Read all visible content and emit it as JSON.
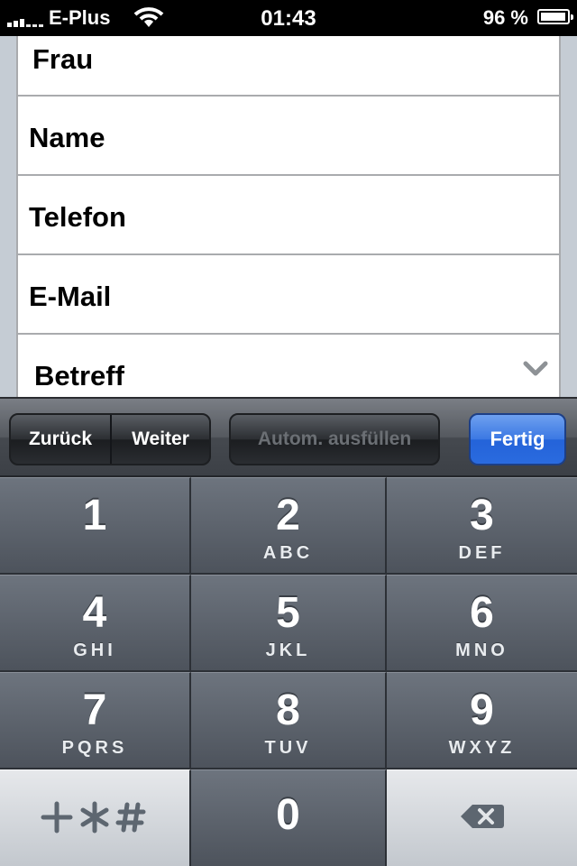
{
  "status_bar": {
    "carrier": "E-Plus",
    "time": "01:43",
    "battery": "96 %",
    "signal_icon": "signal-bars-icon",
    "wifi_icon": "wifi-icon",
    "battery_icon": "battery-icon"
  },
  "form": {
    "fields": [
      {
        "label": "Frau"
      },
      {
        "label": "Name"
      },
      {
        "label": "Telefon"
      },
      {
        "label": "E-Mail"
      },
      {
        "label": "Betreff",
        "icon": "chevron-down-icon"
      }
    ]
  },
  "toolbar": {
    "prev_label": "Zurück",
    "next_label": "Weiter",
    "autofill_label": "Autom. ausfüllen",
    "done_label": "Fertig"
  },
  "keypad": {
    "keys": [
      {
        "num": "1",
        "letters": ""
      },
      {
        "num": "2",
        "letters": "ABC"
      },
      {
        "num": "3",
        "letters": "DEF"
      },
      {
        "num": "4",
        "letters": "GHI"
      },
      {
        "num": "5",
        "letters": "JKL"
      },
      {
        "num": "6",
        "letters": "MNO"
      },
      {
        "num": "7",
        "letters": "PQRS"
      },
      {
        "num": "8",
        "letters": "TUV"
      },
      {
        "num": "9",
        "letters": "WXYZ"
      },
      {
        "num": "0",
        "letters": ""
      }
    ],
    "symbols_label": "+*#",
    "backspace_icon": "backspace-icon"
  },
  "colors": {
    "done_button": "#2a6bdf",
    "key_dark": "#4d535c",
    "key_light": "#c3c8ce"
  }
}
